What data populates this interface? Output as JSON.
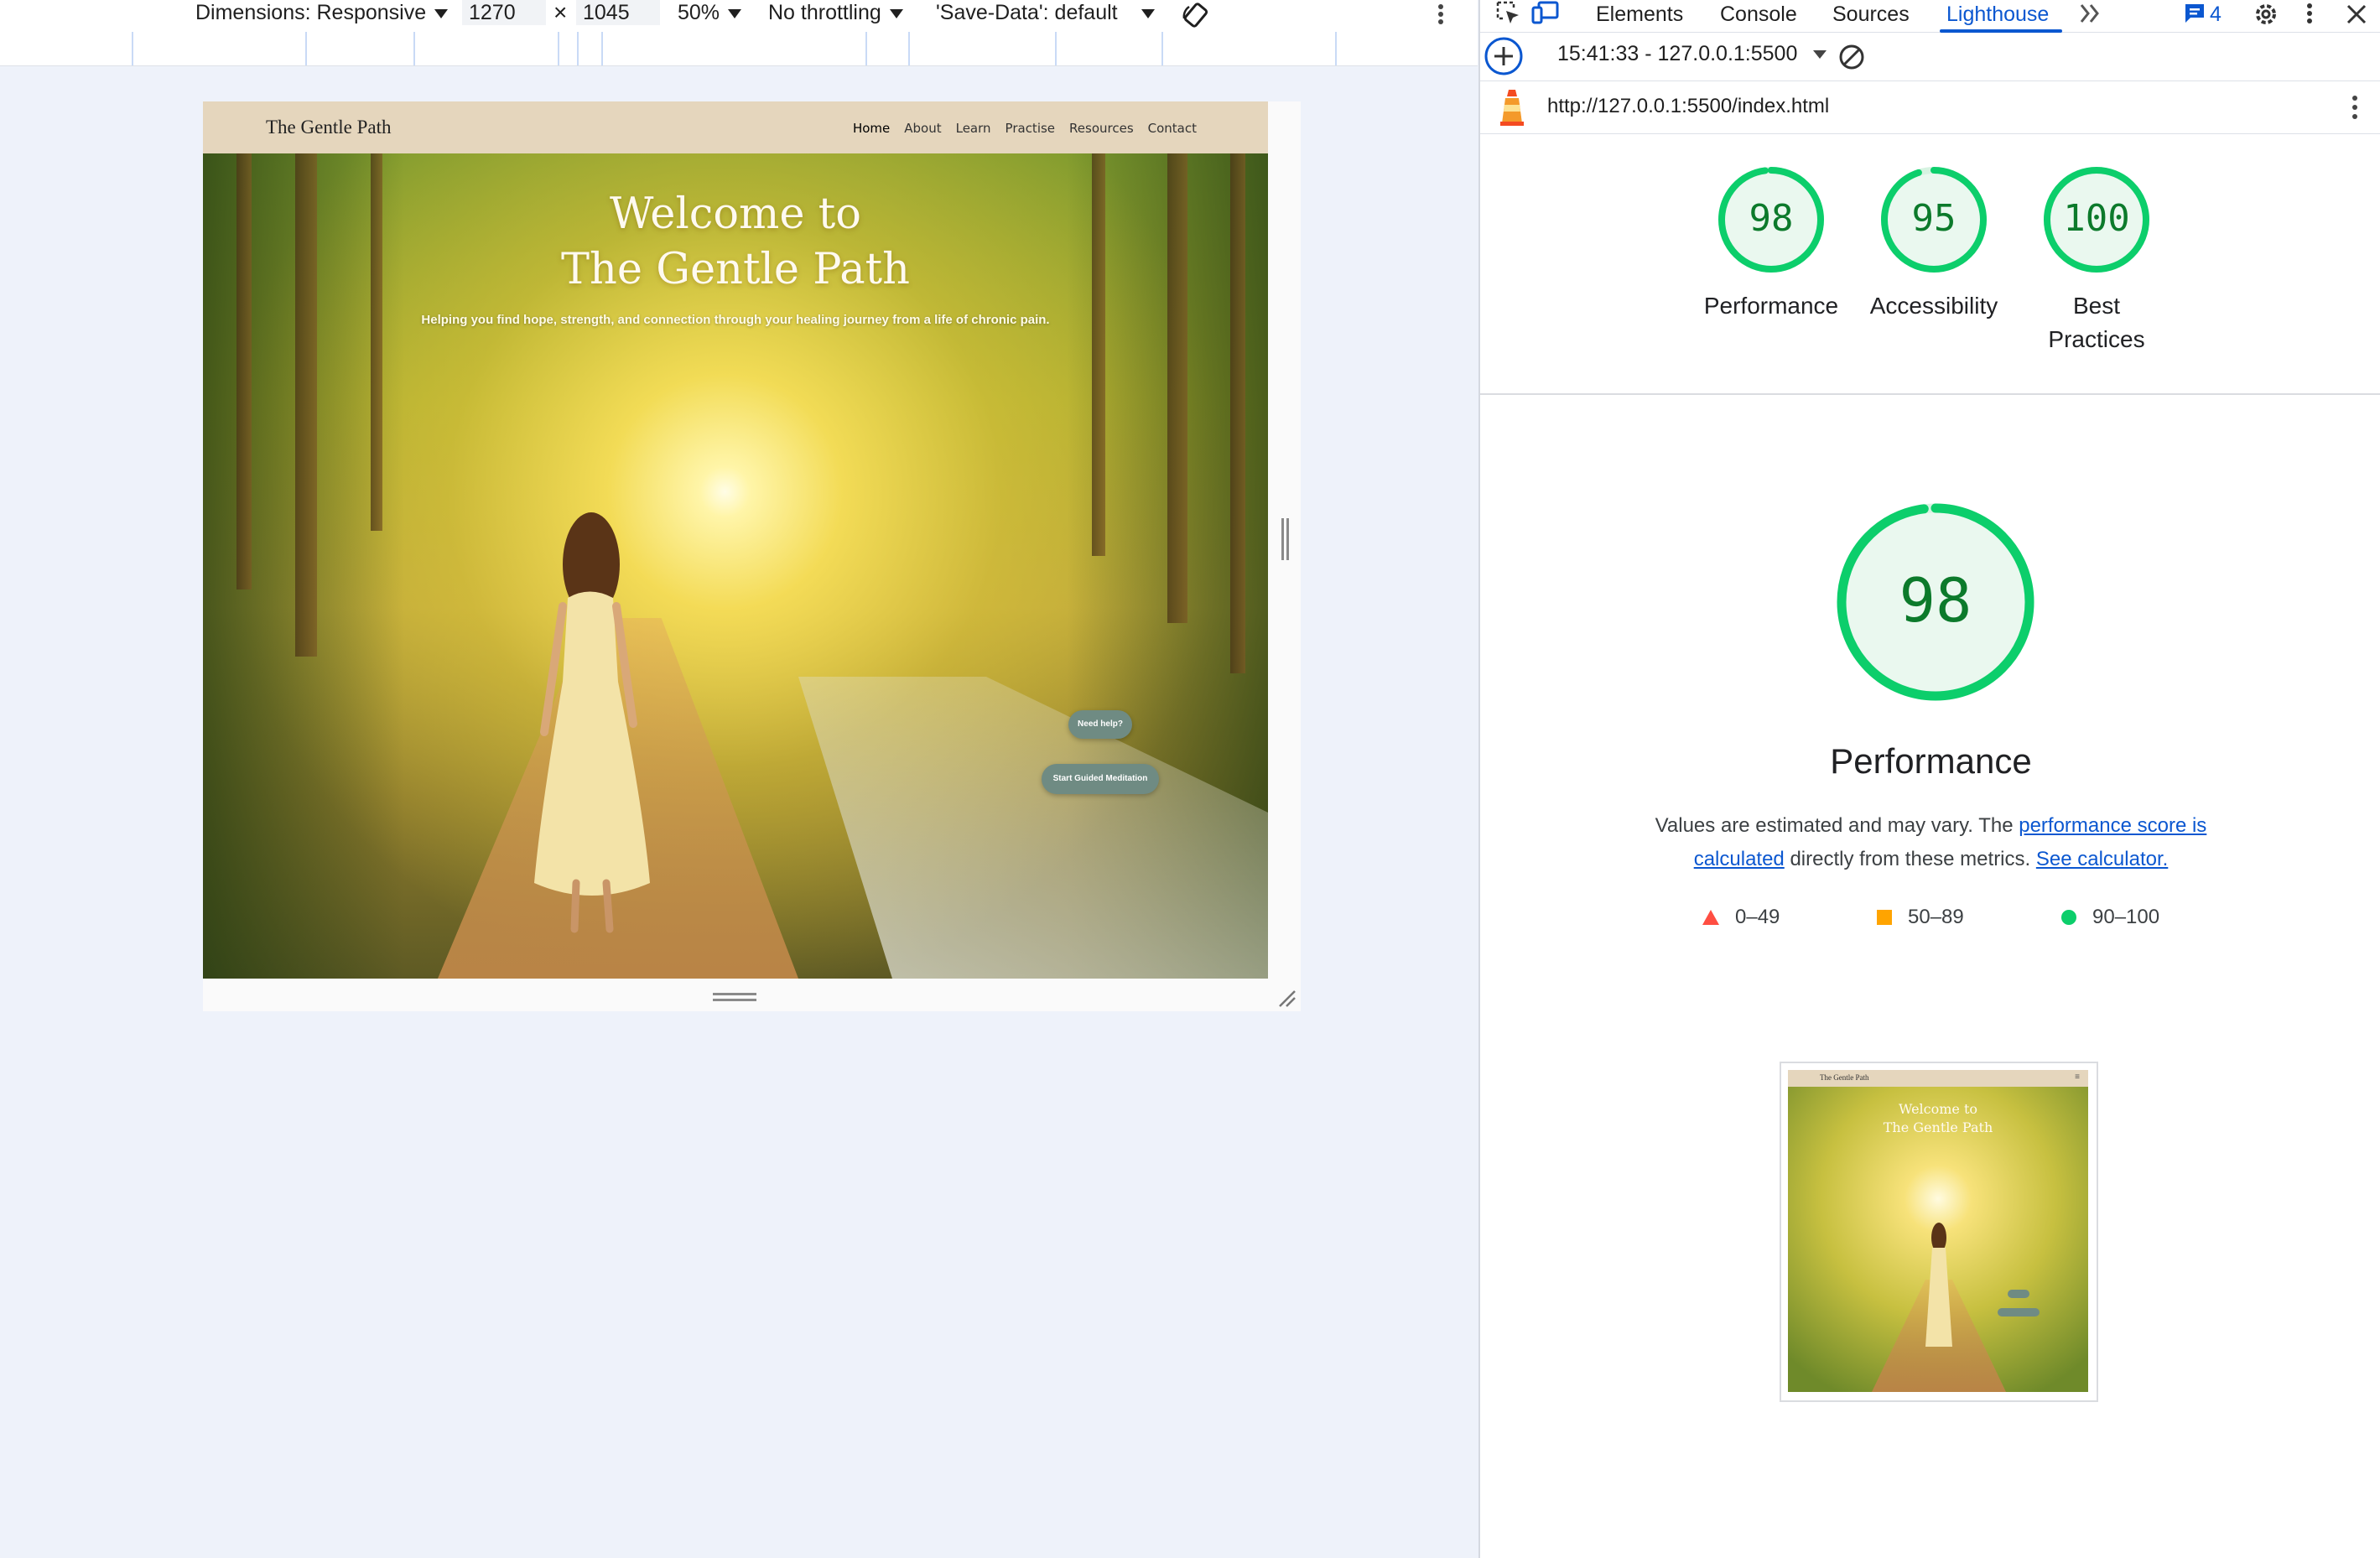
{
  "device_toolbar": {
    "dimensions_label": "Dimensions: Responsive",
    "width": "1270",
    "times": "×",
    "height": "1045",
    "zoom": "50%",
    "throttling": "No throttling",
    "save_data": "'Save-Data': default"
  },
  "site": {
    "brand": "The Gentle Path",
    "nav": [
      "Home",
      "About",
      "Learn",
      "Practise",
      "Resources",
      "Contact"
    ],
    "hero_title_line1": "Welcome to",
    "hero_title_line2": "The Gentle Path",
    "hero_subtitle": "Helping you find hope, strength, and connection through your healing journey from a life of chronic pain.",
    "help_button": "Need help?",
    "meditation_button": "Start Guided Meditation"
  },
  "devtools": {
    "tabs": [
      "Elements",
      "Console",
      "Sources",
      "Lighthouse"
    ],
    "active_tab": "Lighthouse",
    "issues_count": "4",
    "report_selector": "15:41:33 - 127.0.0.1:5500",
    "url": "http://127.0.0.1:5500/index.html"
  },
  "lighthouse": {
    "scores": [
      {
        "label_line1": "Performance",
        "label_line2": "",
        "value": "98",
        "fraction": 0.98
      },
      {
        "label_line1": "Accessibility",
        "label_line2": "",
        "value": "95",
        "fraction": 0.95
      },
      {
        "label_line1": "Best",
        "label_line2": "Practices",
        "value": "100",
        "fraction": 1.0
      }
    ],
    "main_score": "98",
    "main_fraction": 0.98,
    "main_title": "Performance",
    "desc_part1": "Values are estimated and may vary. The ",
    "desc_link1": "performance score is calculated",
    "desc_part2": " directly from these metrics. ",
    "desc_link2": "See calculator.",
    "legend": [
      "0–49",
      "50–89",
      "90–100"
    ],
    "thumbnail": {
      "brand": "The Gentle Path",
      "title_line1": "Welcome to",
      "title_line2": "The Gentle Path"
    },
    "colors": {
      "pass": "#0cce6b",
      "average": "#ffa400",
      "fail": "#ff4e42"
    }
  }
}
